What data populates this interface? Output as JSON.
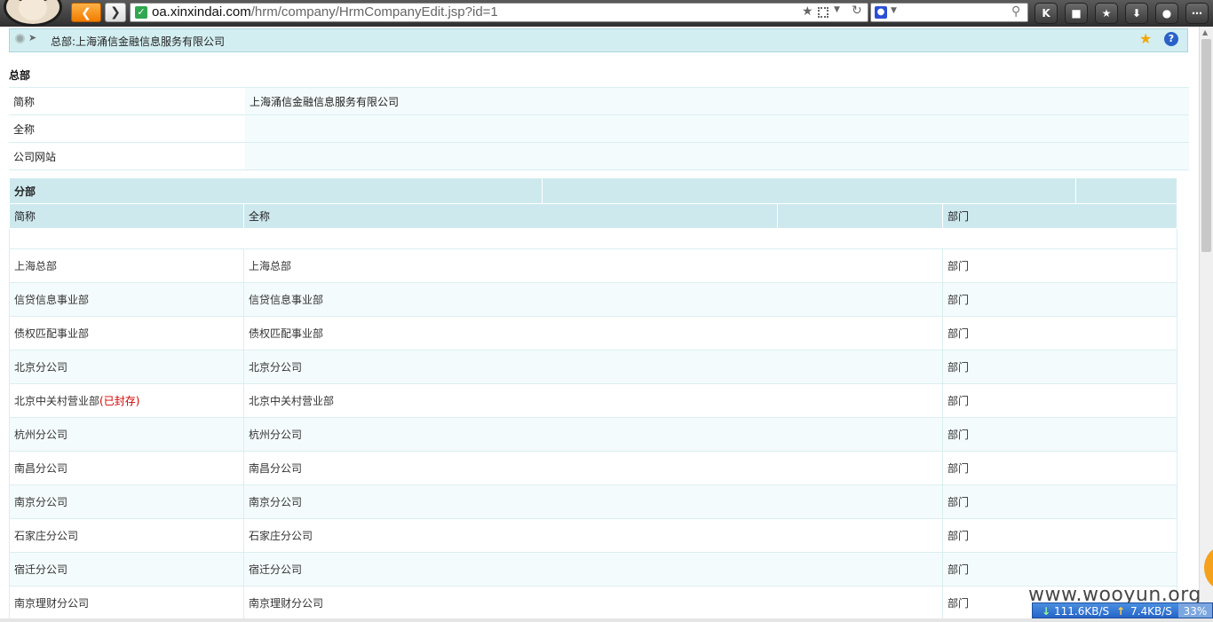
{
  "browser": {
    "url_host": "oa.xinxindai.com",
    "url_path": "/hrm/company/HrmCompanyEdit.jsp?id=1",
    "ext_k_label": "K"
  },
  "header": {
    "title": "总部:上海涌信金融信息服务有限公司"
  },
  "hq": {
    "title": "总部",
    "fields": [
      {
        "label": "简称",
        "value": "上海涌信金融信息服务有限公司"
      },
      {
        "label": "全称",
        "value": ""
      },
      {
        "label": "公司网站",
        "value": ""
      }
    ]
  },
  "branches": {
    "section_title": "分部",
    "columns": {
      "short": "简称",
      "full": "全称",
      "dept": "部门"
    },
    "rows": [
      {
        "short": "上海总部",
        "sealed": "",
        "full": "上海总部",
        "dept": "部门"
      },
      {
        "short": "信贷信息事业部",
        "sealed": "",
        "full": "信贷信息事业部",
        "dept": "部门"
      },
      {
        "short": "债权匹配事业部",
        "sealed": "",
        "full": "债权匹配事业部",
        "dept": "部门"
      },
      {
        "short": "北京分公司",
        "sealed": "",
        "full": "北京分公司",
        "dept": "部门"
      },
      {
        "short": "北京中关村营业部",
        "sealed": "(已封存)",
        "full": "北京中关村营业部",
        "dept": "部门"
      },
      {
        "short": "杭州分公司",
        "sealed": "",
        "full": "杭州分公司",
        "dept": "部门"
      },
      {
        "short": "南昌分公司",
        "sealed": "",
        "full": "南昌分公司",
        "dept": "部门"
      },
      {
        "short": "南京分公司",
        "sealed": "",
        "full": "南京分公司",
        "dept": "部门"
      },
      {
        "short": "石家庄分公司",
        "sealed": "",
        "full": "石家庄分公司",
        "dept": "部门"
      },
      {
        "short": "宿迁分公司",
        "sealed": "",
        "full": "宿迁分公司",
        "dept": "部门"
      },
      {
        "short": "南京理财分公司",
        "sealed": "",
        "full": "南京理财分公司",
        "dept": "部门"
      }
    ]
  },
  "overlay": {
    "watermark": "www.wooyun.org",
    "down_speed": "111.6KB/S",
    "up_speed": "7.4KB/S",
    "cpu": "33%"
  },
  "colors": {
    "header_bg": "#d3eef1",
    "sealed_text": "#d40000",
    "back_button": "#f07b00"
  }
}
